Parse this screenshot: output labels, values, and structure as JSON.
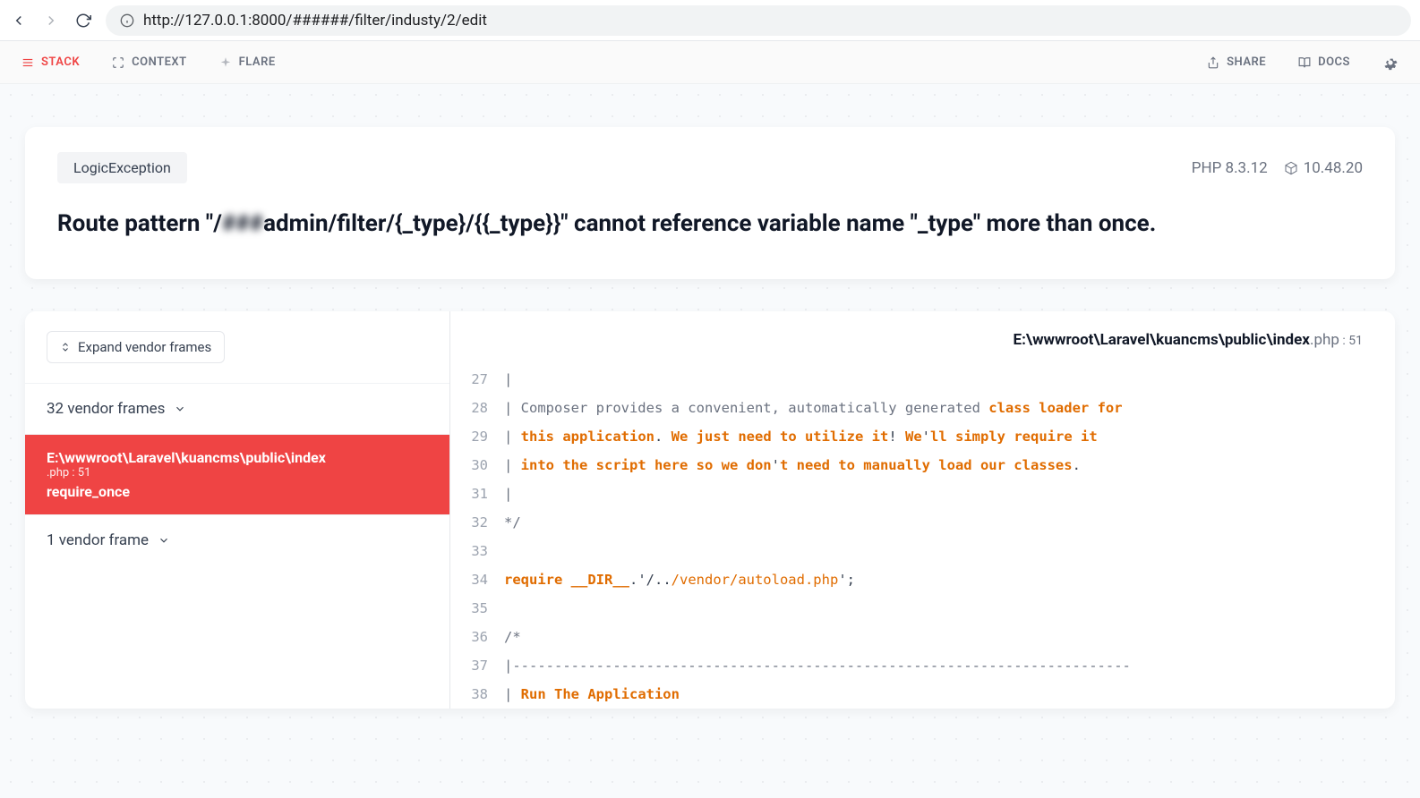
{
  "browser": {
    "url": "http://127.0.0.1:8000/######/filter/industy/2/edit"
  },
  "topnav": {
    "stack": "STACK",
    "context": "CONTEXT",
    "flare": "FLARE",
    "share": "SHARE",
    "docs": "DOCS"
  },
  "error": {
    "exception": "LogicException",
    "php_version": "PHP 8.3.12",
    "laravel_version": "10.48.20",
    "message_pre": "Route pattern \"/",
    "message_blur": "###",
    "message_post": "admin/filter/{_type}/{{_type}}\" cannot reference variable name \"_type\" more than once."
  },
  "stack": {
    "expand_label": "Expand vendor frames",
    "group_top": "32 vendor frames",
    "selected": {
      "path": "E:\\wwwroot\\Laravel\\kuancms\\public\\index",
      "ext_line": ".php : 51",
      "func": "require_once"
    },
    "group_bottom": "1 vendor frame"
  },
  "file": {
    "path_strong": "E:\\wwwroot\\Laravel\\kuancms\\public\\index",
    "ext": ".php",
    "line_sep": " : ",
    "line": "51"
  },
  "code": [
    {
      "n": 27,
      "html": "<span class='tok-cmt'>|</span>"
    },
    {
      "n": 28,
      "html": "<span class='tok-cmt'>| Composer provides a convenient, automatically generated </span><span class='tok-kw'>class</span> <span class='tok-kw'>loader for</span>"
    },
    {
      "n": 29,
      "html": "<span class='tok-cmt'>| </span><span class='tok-kw'>this application</span><span class='tok-punc'>.</span> <span class='tok-kw'>We just need to utilize it</span><span class='tok-punc'>!</span> <span class='tok-kw'>We</span><span class='tok-punc'>'</span><span class='tok-kw'>ll simply require it</span>"
    },
    {
      "n": 30,
      "html": "<span class='tok-cmt'>| </span><span class='tok-kw'>into the script here so we don</span><span class='tok-punc'>'</span><span class='tok-kw'>t need to manually load our classes</span><span class='tok-punc'>.</span>"
    },
    {
      "n": 31,
      "html": "<span class='tok-cmt'>|</span>"
    },
    {
      "n": 32,
      "html": "<span class='tok-cmt'>*/</span>"
    },
    {
      "n": 33,
      "html": ""
    },
    {
      "n": 34,
      "html": "<span class='tok-kw'>require __DIR__</span><span class='tok-punc'>.'</span><span class='tok-punc'>/..</span><span class='tok-str'>/vendor</span><span class='tok-str'>/autoload.php</span><span class='tok-punc'>';</span>"
    },
    {
      "n": 35,
      "html": ""
    },
    {
      "n": 36,
      "html": "<span class='tok-cmt'>/*</span>"
    },
    {
      "n": 37,
      "html": "<span class='tok-cmt'>|--------------------------------------------------------------------------</span>"
    },
    {
      "n": 38,
      "html": "<span class='tok-cmt'>| </span><span class='tok-kw'>Run The Application</span>"
    }
  ]
}
